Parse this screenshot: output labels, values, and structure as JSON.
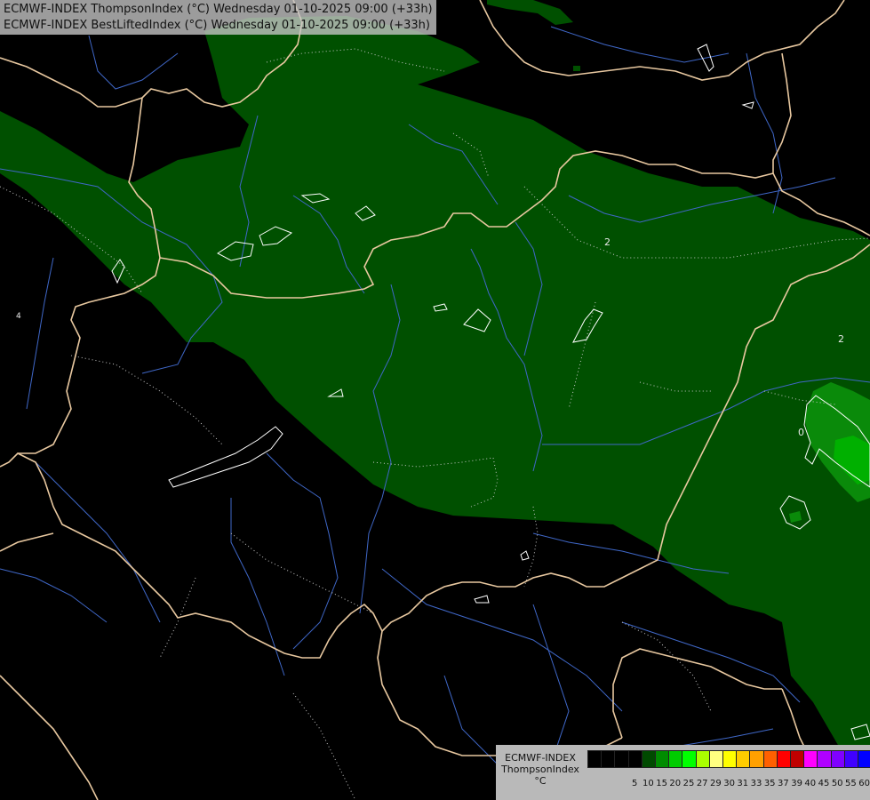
{
  "header": {
    "line1": "ECMWF-INDEX ThompsonIndex (°C) Wednesday 01-10-2025 09:00 (+33h)",
    "line2": "ECMWF-INDEX BestLiftedIndex (°C) Wednesday 01-10-2025 09:00 (+33h)"
  },
  "map": {
    "background_color": "#000000",
    "fill_colors": [
      "#005000",
      "#0a8a0a",
      "#00b000"
    ],
    "contour_labels": [
      {
        "id": "label-2-a",
        "text": "2"
      },
      {
        "id": "label-2-b",
        "text": "2"
      },
      {
        "id": "label-0",
        "text": "0"
      },
      {
        "id": "label-4",
        "text": "4"
      }
    ]
  },
  "legend": {
    "line1": "ECMWF-INDEX",
    "line2": "ThompsonIndex",
    "line3": "°C",
    "ticks": [
      "5",
      "10",
      "15",
      "20",
      "25",
      "27",
      "29",
      "30",
      "31",
      "33",
      "35",
      "37",
      "39",
      "40",
      "45",
      "50",
      "55",
      "60"
    ],
    "colors": [
      "#000000",
      "#000000",
      "#000000",
      "#000000",
      "#004a00",
      "#008c00",
      "#00cc00",
      "#00ff00",
      "#aaff00",
      "#ffff80",
      "#ffff00",
      "#ffcc00",
      "#ffa000",
      "#ff6000",
      "#ff0000",
      "#c00000",
      "#ff00ff",
      "#b000ff",
      "#8000ff",
      "#4000ff",
      "#0000ff"
    ]
  }
}
